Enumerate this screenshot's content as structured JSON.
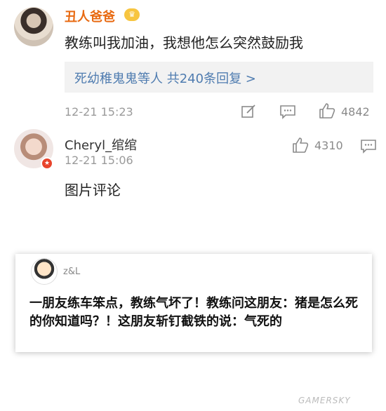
{
  "comment1": {
    "username": "丑人爸爸",
    "badge": "♛",
    "text": "教练叫我加油，我想他怎么突然鼓励我",
    "replies_summary": "死幼稚鬼鬼等人  共240条回复 >",
    "time": "12-21 15:23",
    "like_count": "4842"
  },
  "comment2": {
    "username": "Cheryl_绾绾",
    "vip_badge": "★",
    "time": "12-21 15:06",
    "like_count": "4310",
    "text": "图片评论"
  },
  "image_card": {
    "user": "z&L",
    "text": "一朋友练车笨点，教练气坏了！教练问这朋友：猪是怎么死的你知道吗？！这朋友斩钉截铁的说：气死的"
  },
  "watermark": "GAMERSKY",
  "icons": {
    "edit": "edit-icon",
    "comment": "comment-icon",
    "like": "thumbs-up-icon"
  },
  "colors": {
    "username_highlight": "#e86a12",
    "link_blue": "#4f7cb0",
    "meta_gray": "#9a9a9a"
  }
}
